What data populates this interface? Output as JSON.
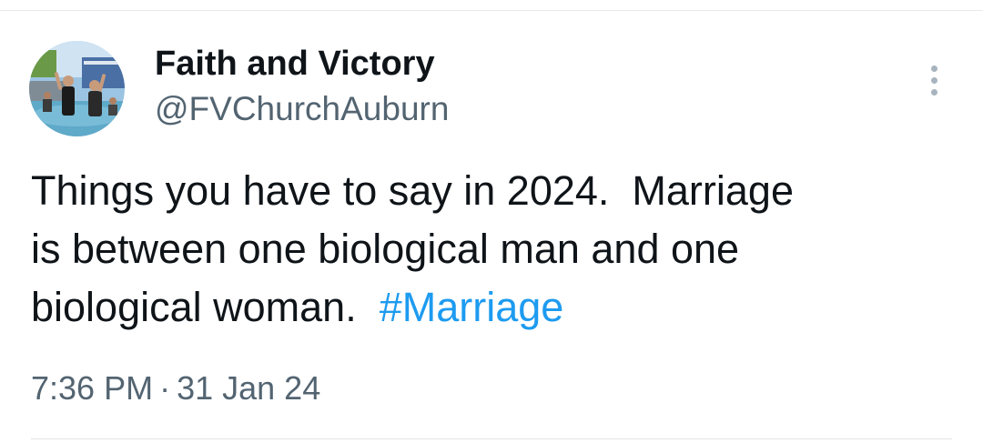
{
  "tweet": {
    "author": {
      "display_name": "Faith and Victory",
      "handle": "@FVChurchAuburn",
      "avatar_icon": "profile-photo-baptism"
    },
    "text_lines": [
      "Things you have to say in 2024.  Marriage",
      "is between one biological man and one",
      "biological woman.  "
    ],
    "hashtag": "#Marriage",
    "time": "7:36 PM",
    "separator": "·",
    "date": "31 Jan 24",
    "more_icon": "more-vertical-icon"
  },
  "colors": {
    "text": "#0f1419",
    "secondary": "#536471",
    "link": "#1d9bf0",
    "divider": "#e7e9ea"
  }
}
